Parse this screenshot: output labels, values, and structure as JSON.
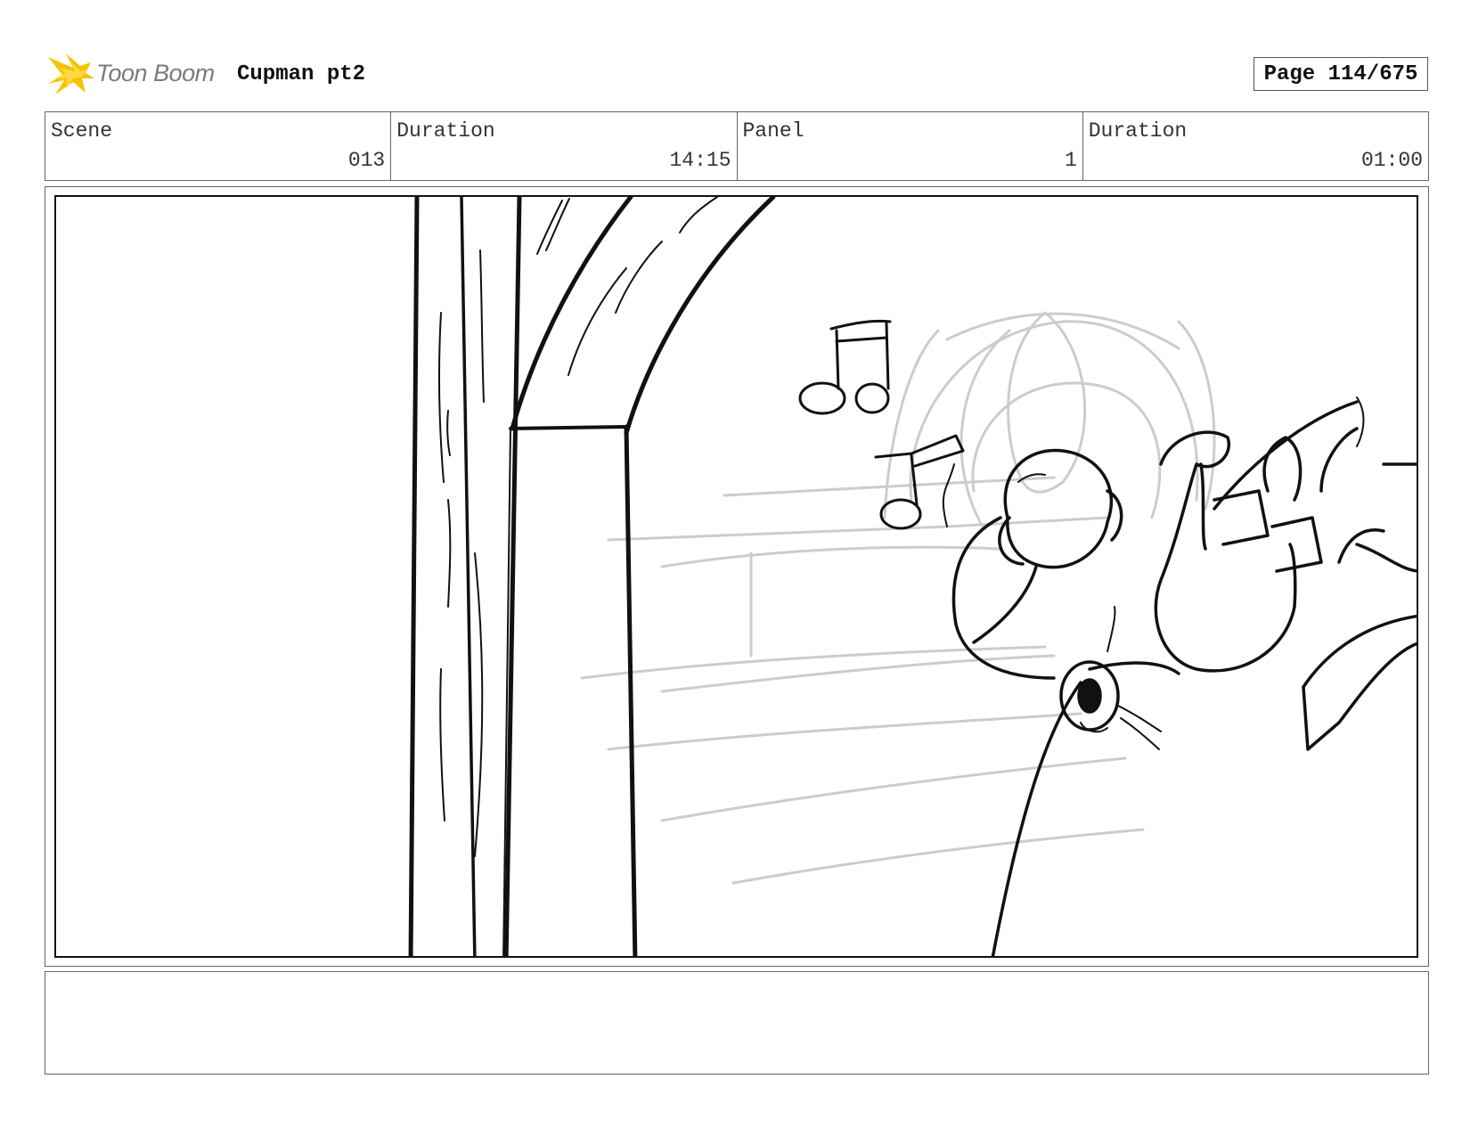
{
  "header": {
    "brand": "Toon Boom",
    "logo_icon": "starburst-icon",
    "project_title": "Cupman pt2",
    "page_label": "Page 114/675"
  },
  "info": {
    "scene_label": "Scene",
    "scene_value": "013",
    "scene_duration_label": "Duration",
    "scene_duration_value": "14:15",
    "panel_label": "Panel",
    "panel_value": "1",
    "panel_duration_label": "Duration",
    "panel_duration_value": "01:00"
  },
  "notes": {
    "text": ""
  },
  "colors": {
    "logo_yellow": "#f5c400",
    "logo_text": "#7a7a7a",
    "ink": "#111111",
    "rough_sketch": "#cccccc"
  }
}
